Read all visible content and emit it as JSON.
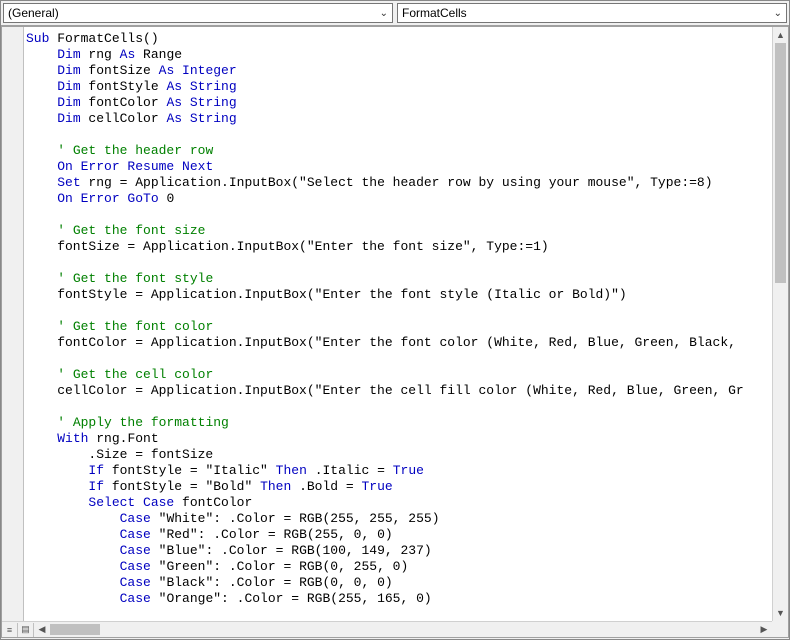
{
  "dropdowns": {
    "object": "(General)",
    "procedure": "FormatCells"
  },
  "code_tokens": [
    [
      [
        "kw",
        "Sub"
      ],
      [
        "",
        " FormatCells()"
      ]
    ],
    [
      [
        "",
        "    "
      ],
      [
        "kw",
        "Dim"
      ],
      [
        "",
        " rng "
      ],
      [
        "kw",
        "As"
      ],
      [
        "",
        " Range"
      ]
    ],
    [
      [
        "",
        "    "
      ],
      [
        "kw",
        "Dim"
      ],
      [
        "",
        " fontSize "
      ],
      [
        "kw",
        "As Integer"
      ]
    ],
    [
      [
        "",
        "    "
      ],
      [
        "kw",
        "Dim"
      ],
      [
        "",
        " fontStyle "
      ],
      [
        "kw",
        "As String"
      ]
    ],
    [
      [
        "",
        "    "
      ],
      [
        "kw",
        "Dim"
      ],
      [
        "",
        " fontColor "
      ],
      [
        "kw",
        "As String"
      ]
    ],
    [
      [
        "",
        "    "
      ],
      [
        "kw",
        "Dim"
      ],
      [
        "",
        " cellColor "
      ],
      [
        "kw",
        "As String"
      ]
    ],
    [],
    [
      [
        "",
        "    "
      ],
      [
        "cm",
        "' Get the header row"
      ]
    ],
    [
      [
        "",
        "    "
      ],
      [
        "kw",
        "On Error Resume Next"
      ]
    ],
    [
      [
        "",
        "    "
      ],
      [
        "kw",
        "Set"
      ],
      [
        "",
        " rng = Application.InputBox(\"Select the header row by using your mouse\", Type:=8)"
      ]
    ],
    [
      [
        "",
        "    "
      ],
      [
        "kw",
        "On Error GoTo"
      ],
      [
        "",
        " 0"
      ]
    ],
    [],
    [
      [
        "",
        "    "
      ],
      [
        "cm",
        "' Get the font size"
      ]
    ],
    [
      [
        "",
        "    fontSize = Application.InputBox(\"Enter the font size\", Type:=1)"
      ]
    ],
    [],
    [
      [
        "",
        "    "
      ],
      [
        "cm",
        "' Get the font style"
      ]
    ],
    [
      [
        "",
        "    fontStyle = Application.InputBox(\"Enter the font style (Italic or Bold)\")"
      ]
    ],
    [],
    [
      [
        "",
        "    "
      ],
      [
        "cm",
        "' Get the font color"
      ]
    ],
    [
      [
        "",
        "    fontColor = Application.InputBox(\"Enter the font color (White, Red, Blue, Green, Black, "
      ]
    ],
    [],
    [
      [
        "",
        "    "
      ],
      [
        "cm",
        "' Get the cell color"
      ]
    ],
    [
      [
        "",
        "    cellColor = Application.InputBox(\"Enter the cell fill color (White, Red, Blue, Green, Gr"
      ]
    ],
    [],
    [
      [
        "",
        "    "
      ],
      [
        "cm",
        "' Apply the formatting"
      ]
    ],
    [
      [
        "",
        "    "
      ],
      [
        "kw",
        "With"
      ],
      [
        "",
        " rng.Font"
      ]
    ],
    [
      [
        "",
        "        .Size = fontSize"
      ]
    ],
    [
      [
        "",
        "        "
      ],
      [
        "kw",
        "If"
      ],
      [
        "",
        " fontStyle = \"Italic\" "
      ],
      [
        "kw",
        "Then"
      ],
      [
        "",
        " .Italic = "
      ],
      [
        "kw",
        "True"
      ]
    ],
    [
      [
        "",
        "        "
      ],
      [
        "kw",
        "If"
      ],
      [
        "",
        " fontStyle = \"Bold\" "
      ],
      [
        "kw",
        "Then"
      ],
      [
        "",
        " .Bold = "
      ],
      [
        "kw",
        "True"
      ]
    ],
    [
      [
        "",
        "        "
      ],
      [
        "kw",
        "Select Case"
      ],
      [
        "",
        " fontColor"
      ]
    ],
    [
      [
        "",
        "            "
      ],
      [
        "kw",
        "Case"
      ],
      [
        "",
        " \"White\": .Color = RGB(255, 255, 255)"
      ]
    ],
    [
      [
        "",
        "            "
      ],
      [
        "kw",
        "Case"
      ],
      [
        "",
        " \"Red\": .Color = RGB(255, 0, 0)"
      ]
    ],
    [
      [
        "",
        "            "
      ],
      [
        "kw",
        "Case"
      ],
      [
        "",
        " \"Blue\": .Color = RGB(100, 149, 237)"
      ]
    ],
    [
      [
        "",
        "            "
      ],
      [
        "kw",
        "Case"
      ],
      [
        "",
        " \"Green\": .Color = RGB(0, 255, 0)"
      ]
    ],
    [
      [
        "",
        "            "
      ],
      [
        "kw",
        "Case"
      ],
      [
        "",
        " \"Black\": .Color = RGB(0, 0, 0)"
      ]
    ],
    [
      [
        "",
        "            "
      ],
      [
        "kw",
        "Case"
      ],
      [
        "",
        " \"Orange\": .Color = RGB(255, 165, 0)"
      ]
    ]
  ]
}
